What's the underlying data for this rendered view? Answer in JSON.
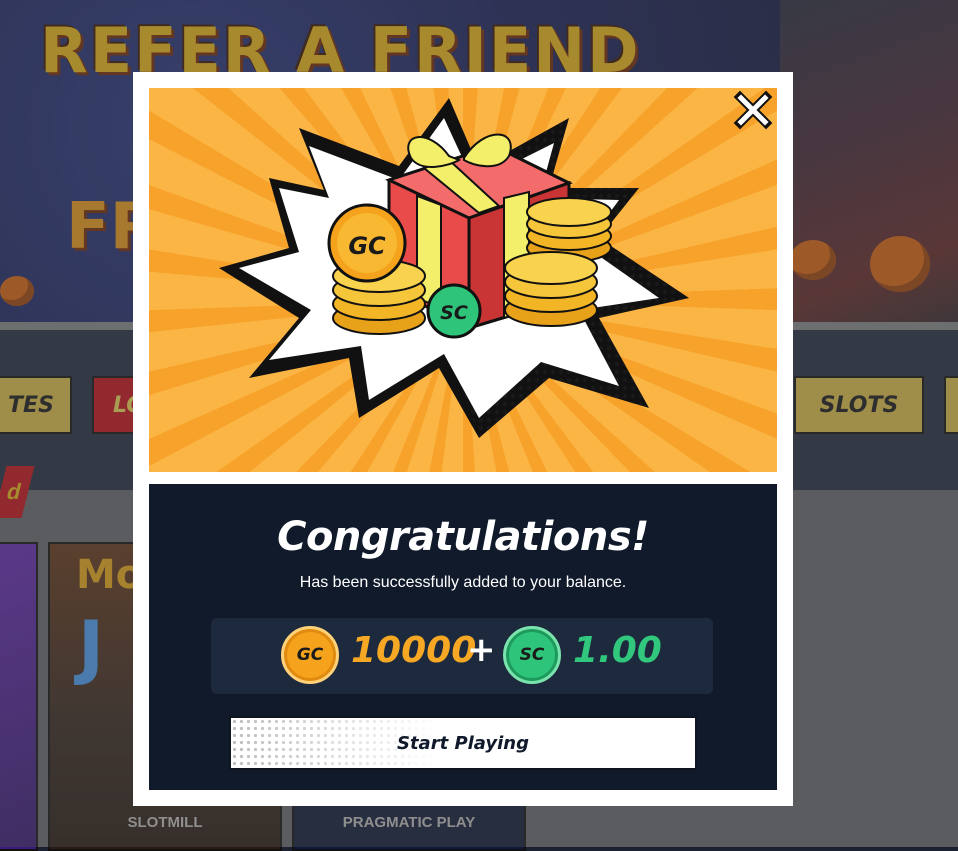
{
  "background": {
    "banner_line1": "REFER A FRIEND",
    "banner_line2": "FR",
    "nav_items": [
      "TES",
      "LO",
      "SLOTS"
    ],
    "side_tag": "d",
    "games": [
      {
        "provider": "SLOTMILL",
        "title_fragment": "Mo",
        "subtitle_fragment": "J"
      },
      {
        "provider": "PRAGMATIC PLAY"
      }
    ]
  },
  "modal": {
    "title": "Congratulations!",
    "subtitle": "Has been successfully added to your balance.",
    "hero_coin_gc_label": "GC",
    "hero_coin_sc_label": "SC",
    "reward": {
      "gc_label": "GC",
      "gc_amount": "10000",
      "plus": "+",
      "sc_label": "SC",
      "sc_amount": "1.00"
    },
    "cta_label": "Start Playing",
    "close_icon": "close-x-icon"
  },
  "colors": {
    "panel_bg": "#101a2b",
    "gold_coin": "#f5a21c",
    "sweeps_coin": "#2ec47a",
    "hero_orange": "#fbb544"
  }
}
